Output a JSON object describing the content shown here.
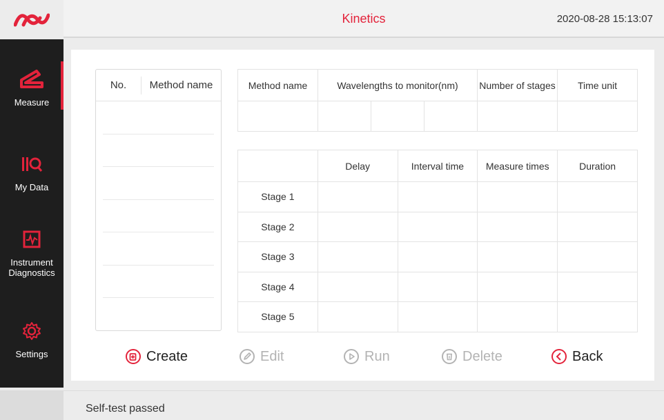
{
  "header": {
    "title": "Kinetics",
    "datetime": "2020-08-28 15:13:07",
    "brand_color": "#e3233b"
  },
  "sidebar": {
    "items": [
      {
        "label": "Measure",
        "icon": "measure-icon",
        "active": true
      },
      {
        "label": "My Data",
        "icon": "my-data-icon",
        "active": false
      },
      {
        "label": "Instrument Diagnostics",
        "icon": "diagnostics-icon",
        "active": false
      },
      {
        "label": "Settings",
        "icon": "gear-icon",
        "active": false
      }
    ]
  },
  "method_list": {
    "columns": [
      "No.",
      "Method name"
    ],
    "rows": []
  },
  "method_info": {
    "columns": [
      "Method name",
      "Wavelengths to monitor(nm)",
      "Number of stages",
      "Time unit"
    ],
    "values": [
      "",
      "",
      "",
      "",
      "",
      "",
      ""
    ]
  },
  "stages": {
    "columns": [
      "",
      "Delay",
      "Interval time",
      "Measure times",
      "Duration"
    ],
    "rows": [
      {
        "name": "Stage 1",
        "delay": "",
        "interval": "",
        "times": "",
        "duration": ""
      },
      {
        "name": "Stage 2",
        "delay": "",
        "interval": "",
        "times": "",
        "duration": ""
      },
      {
        "name": "Stage 3",
        "delay": "",
        "interval": "",
        "times": "",
        "duration": ""
      },
      {
        "name": "Stage 4",
        "delay": "",
        "interval": "",
        "times": "",
        "duration": ""
      },
      {
        "name": "Stage 5",
        "delay": "",
        "interval": "",
        "times": "",
        "duration": ""
      }
    ]
  },
  "actions": {
    "create": "Create",
    "edit": "Edit",
    "run": "Run",
    "delete": "Delete",
    "back": "Back"
  },
  "status": {
    "text": "Self-test passed"
  }
}
